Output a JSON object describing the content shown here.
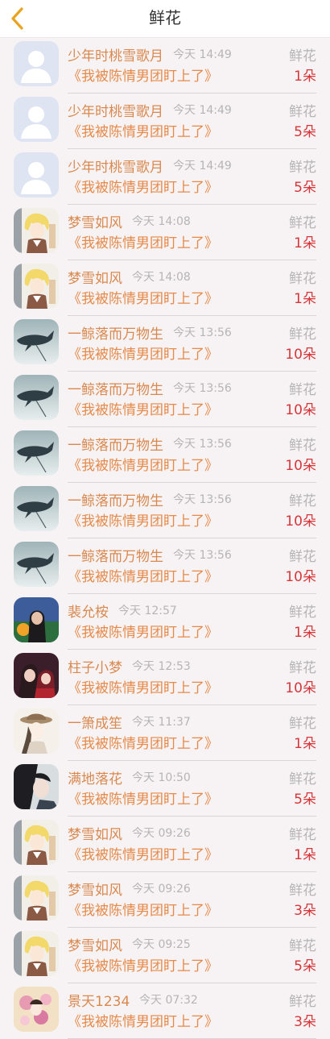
{
  "header": {
    "title": "鲜花",
    "back_icon": "chevron-left-icon",
    "accent": "#e8a321"
  },
  "colors": {
    "name": "#d9894f",
    "book": "#e58a4a",
    "count": "#d6363a",
    "muted": "#b5b5b5"
  },
  "rows": [
    {
      "name": "少年时桃雪歌月",
      "time": "今天 14:49",
      "kind": "鲜花",
      "book": "《我被陈情男团盯上了》",
      "count": "1朵",
      "avatar": "default"
    },
    {
      "name": "少年时桃雪歌月",
      "time": "今天 14:49",
      "kind": "鲜花",
      "book": "《我被陈情男团盯上了》",
      "count": "5朵",
      "avatar": "default"
    },
    {
      "name": "少年时桃雪歌月",
      "time": "今天 14:49",
      "kind": "鲜花",
      "book": "《我被陈情男团盯上了》",
      "count": "5朵",
      "avatar": "default"
    },
    {
      "name": "梦雪如风",
      "time": "今天 14:08",
      "kind": "鲜花",
      "book": "《我被陈情男团盯上了》",
      "count": "1朵",
      "avatar": "anime-blond"
    },
    {
      "name": "梦雪如风",
      "time": "今天 14:08",
      "kind": "鲜花",
      "book": "《我被陈情男团盯上了》",
      "count": "1朵",
      "avatar": "anime-blond"
    },
    {
      "name": "一鲸落而万物生",
      "time": "今天 13:56",
      "kind": "鲜花",
      "book": "《我被陈情男团盯上了》",
      "count": "10朵",
      "avatar": "whale"
    },
    {
      "name": "一鲸落而万物生",
      "time": "今天 13:56",
      "kind": "鲜花",
      "book": "《我被陈情男团盯上了》",
      "count": "10朵",
      "avatar": "whale"
    },
    {
      "name": "一鲸落而万物生",
      "time": "今天 13:56",
      "kind": "鲜花",
      "book": "《我被陈情男团盯上了》",
      "count": "10朵",
      "avatar": "whale"
    },
    {
      "name": "一鲸落而万物生",
      "time": "今天 13:56",
      "kind": "鲜花",
      "book": "《我被陈情男团盯上了》",
      "count": "10朵",
      "avatar": "whale"
    },
    {
      "name": "一鲸落而万物生",
      "time": "今天 13:56",
      "kind": "鲜花",
      "book": "《我被陈情男团盯上了》",
      "count": "10朵",
      "avatar": "whale"
    },
    {
      "name": "裴允桉",
      "time": "今天 12:57",
      "kind": "鲜花",
      "book": "《我被陈情男团盯上了》",
      "count": "1朵",
      "avatar": "photo-girl"
    },
    {
      "name": "柱子小梦",
      "time": "今天 12:53",
      "kind": "鲜花",
      "book": "《我被陈情男团盯上了》",
      "count": "10朵",
      "avatar": "red-couple"
    },
    {
      "name": "一箫成笙",
      "time": "今天 11:37",
      "kind": "鲜花",
      "book": "《我被陈情男团盯上了》",
      "count": "1朵",
      "avatar": "sketch-hat"
    },
    {
      "name": "满地落花",
      "time": "今天 10:50",
      "kind": "鲜花",
      "book": "《我被陈情男团盯上了》",
      "count": "5朵",
      "avatar": "dark-hair"
    },
    {
      "name": "梦雪如风",
      "time": "今天 09:26",
      "kind": "鲜花",
      "book": "《我被陈情男团盯上了》",
      "count": "1朵",
      "avatar": "anime-blond"
    },
    {
      "name": "梦雪如风",
      "time": "今天 09:26",
      "kind": "鲜花",
      "book": "《我被陈情男团盯上了》",
      "count": "3朵",
      "avatar": "anime-blond"
    },
    {
      "name": "梦雪如风",
      "time": "今天 09:25",
      "kind": "鲜花",
      "book": "《我被陈情男团盯上了》",
      "count": "5朵",
      "avatar": "anime-blond"
    },
    {
      "name": "景天1234",
      "time": "今天 07:32",
      "kind": "鲜花",
      "book": "《我被陈情男团盯上了》",
      "count": "3朵",
      "avatar": "flowers"
    }
  ]
}
